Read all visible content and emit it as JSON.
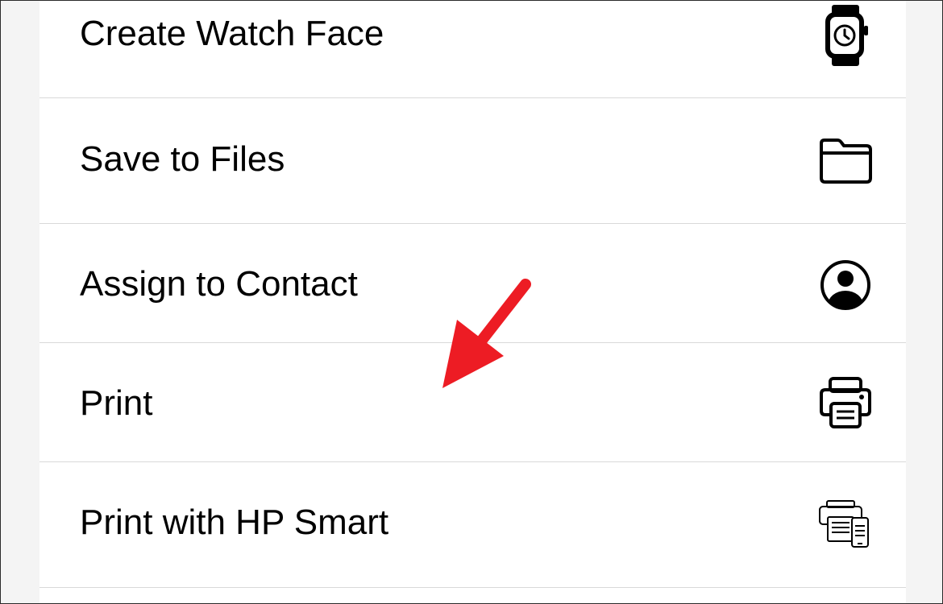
{
  "share_sheet": {
    "actions": [
      {
        "label": "Create Watch Face",
        "icon": "watch-icon"
      },
      {
        "label": "Save to Files",
        "icon": "folder-icon"
      },
      {
        "label": "Assign to Contact",
        "icon": "person-circle-icon"
      },
      {
        "label": "Print",
        "icon": "printer-icon"
      },
      {
        "label": "Print with HP Smart",
        "icon": "hp-smart-icon"
      }
    ]
  },
  "annotation": {
    "arrow_color": "#ed1c24",
    "arrow_icon": "arrow-icon"
  }
}
